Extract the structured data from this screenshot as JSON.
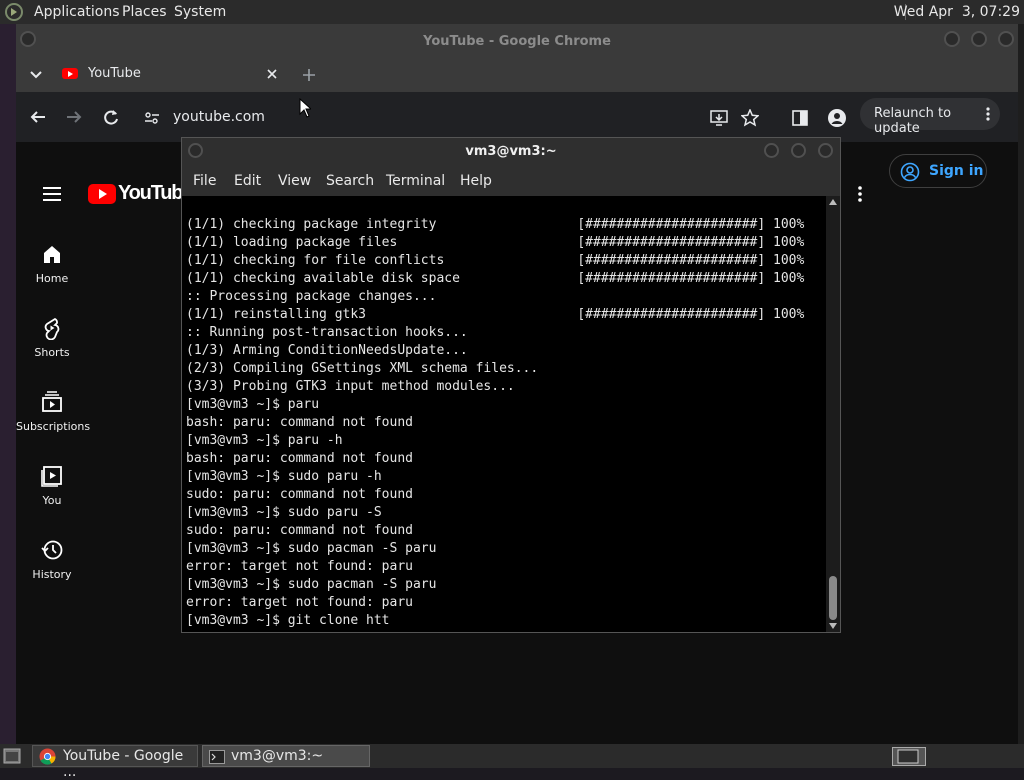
{
  "top_panel": {
    "menus": [
      "Applications",
      "Places",
      "System"
    ],
    "clock": "Wed Apr  3, 07:29"
  },
  "chrome": {
    "window_title": "YouTube - Google Chrome",
    "tab": {
      "label": "YouTube"
    },
    "omnibox": {
      "url": "youtube.com"
    },
    "relaunch_label": "Relaunch to update"
  },
  "youtube": {
    "logo_text": "YouTube",
    "sign_in_label": "Sign in",
    "guide": [
      "Home",
      "Shorts",
      "Subscriptions",
      "You",
      "History"
    ]
  },
  "terminal": {
    "title": "vm3@vm3:~",
    "menu": [
      "File",
      "Edit",
      "View",
      "Search",
      "Terminal",
      "Help"
    ],
    "lines": [
      "(1/1) checking package integrity                  [######################] 100%",
      "(1/1) loading package files                       [######################] 100%",
      "(1/1) checking for file conflicts                 [######################] 100%",
      "(1/1) checking available disk space               [######################] 100%",
      ":: Processing package changes...",
      "(1/1) reinstalling gtk3                           [######################] 100%",
      ":: Running post-transaction hooks...",
      "(1/3) Arming ConditionNeedsUpdate...",
      "(2/3) Compiling GSettings XML schema files...",
      "(3/3) Probing GTK3 input method modules...",
      "[vm3@vm3 ~]$ paru",
      "bash: paru: command not found",
      "[vm3@vm3 ~]$ paru -h",
      "bash: paru: command not found",
      "[vm3@vm3 ~]$ sudo paru -h",
      "sudo: paru: command not found",
      "[vm3@vm3 ~]$ sudo paru -S",
      "sudo: paru: command not found",
      "[vm3@vm3 ~]$ sudo pacman -S paru",
      "error: target not found: paru",
      "[vm3@vm3 ~]$ sudo pacman -S paru",
      "error: target not found: paru",
      "[vm3@vm3 ~]$ git clone htt"
    ]
  },
  "taskbar": {
    "tasks": [
      "YouTube - Google ...",
      "vm3@vm3:~"
    ]
  }
}
